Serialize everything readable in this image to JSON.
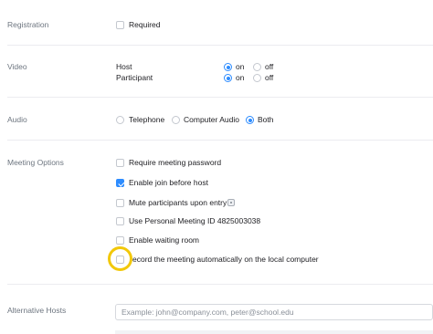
{
  "registration": {
    "section_label": "Registration",
    "required": {
      "label": "Required",
      "checked": false
    }
  },
  "video": {
    "section_label": "Video",
    "host": {
      "label": "Host",
      "on_label": "on",
      "off_label": "off",
      "selected": "on"
    },
    "participant": {
      "label": "Participant",
      "on_label": "on",
      "off_label": "off",
      "selected": "on"
    }
  },
  "audio": {
    "section_label": "Audio",
    "options": [
      {
        "label": "Telephone",
        "selected": false
      },
      {
        "label": "Computer Audio",
        "selected": false
      },
      {
        "label": "Both",
        "selected": true
      }
    ]
  },
  "meeting_options": {
    "section_label": "Meeting Options",
    "items": [
      {
        "label": "Require meeting password",
        "checked": false
      },
      {
        "label": "Enable join before host",
        "checked": true
      },
      {
        "label": "Mute participants upon entry",
        "checked": false
      },
      {
        "label": "Use Personal Meeting ID 4825003038",
        "checked": false
      },
      {
        "label": "Enable waiting room",
        "checked": false
      },
      {
        "label": "ecord the meeting automatically on the local computer",
        "checked": false
      }
    ]
  },
  "alternative_hosts": {
    "section_label": "Alternative Hosts",
    "placeholder": "Example: john@company.com, peter@school.edu",
    "value": ""
  },
  "colors": {
    "accent": "#2d8cff",
    "highlight": "#f2c80a"
  }
}
